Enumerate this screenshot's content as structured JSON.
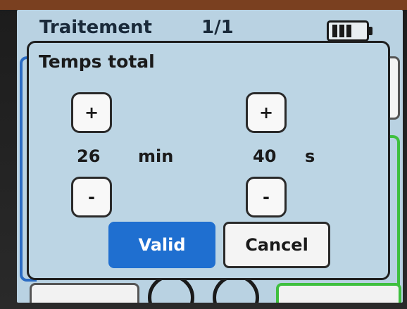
{
  "background": {
    "title": "Traitement",
    "page_indicator": "1/1",
    "battery_icon": "battery-icon"
  },
  "dialog": {
    "title": "Temps total",
    "minutes": {
      "value": "26",
      "unit": "min",
      "increment_label": "+",
      "decrement_label": "-"
    },
    "seconds": {
      "value": "40",
      "unit": "s",
      "increment_label": "+",
      "decrement_label": "-"
    },
    "valid_label": "Valid",
    "cancel_label": "Cancel"
  },
  "colors": {
    "screen_bg": "#b9d2e2",
    "accent_blue": "#1f6fd0",
    "status_green": "#3fbf3f"
  }
}
